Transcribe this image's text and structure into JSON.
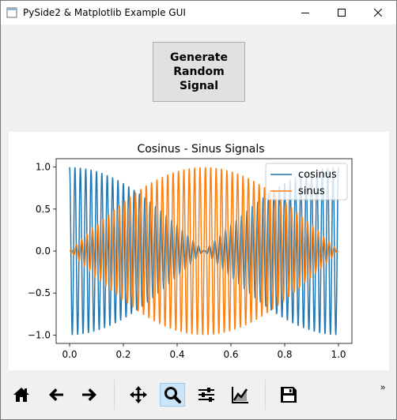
{
  "window": {
    "title": "PySide2 & Matplotlib Example GUI",
    "controls": [
      "minimize-icon",
      "maximize-icon",
      "close-icon"
    ]
  },
  "generate_button": {
    "lines": [
      "Generate",
      "Random",
      "Signal"
    ]
  },
  "chart_data": {
    "type": "line",
    "title": "Cosinus - Sinus Signals",
    "xlabel": "",
    "ylabel": "",
    "xlim": [
      -0.05,
      1.05
    ],
    "ylim": [
      -1.1,
      1.1
    ],
    "x_ticks": [
      "0.0",
      "0.2",
      "0.4",
      "0.6",
      "0.8",
      "1.0"
    ],
    "y_ticks": [
      "1.0",
      "0.5",
      "0.0",
      "−0.5",
      "−1.0"
    ],
    "legend_position": "top-right",
    "series": [
      {
        "name": "cosinus",
        "color": "#1f77b4",
        "formula": "cos(2*pi*50*x) * |cos(pi*x)|",
        "x_range": [
          0,
          1
        ],
        "points": 1200
      },
      {
        "name": "sinus",
        "color": "#ff7f0e",
        "formula": "sin(2*pi*50*x) * sin(pi*x)",
        "x_range": [
          0,
          1
        ],
        "points": 1200
      }
    ]
  },
  "toolbar": {
    "tools": [
      "home-icon",
      "back-arrow-icon",
      "forward-arrow-icon",
      "pan-icon",
      "zoom-icon",
      "configure-subplots-icon",
      "edit-axes-icon",
      "save-icon"
    ],
    "overflow": "»"
  }
}
